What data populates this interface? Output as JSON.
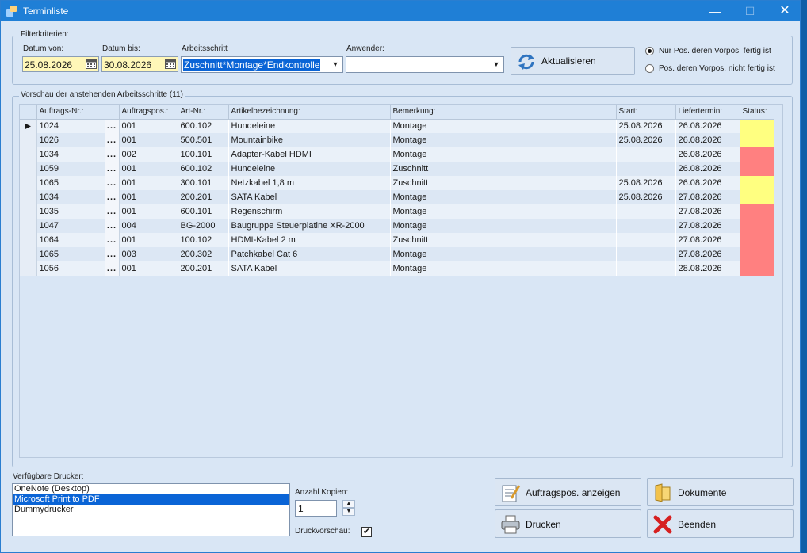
{
  "window": {
    "title": "Terminliste",
    "min": "—",
    "max": "☐",
    "close": "✕"
  },
  "filter": {
    "group_label": "Filterkriterien:",
    "date_from_label": "Datum von:",
    "date_from": "25.08.2026",
    "date_to_label": "Datum bis:",
    "date_to": "30.08.2026",
    "step_label": "Arbeitsschritt",
    "step_value": "Zuschnitt*Montage*Endkontrolle",
    "user_label": "Anwender:",
    "user_value": "",
    "refresh_label": "Aktualisieren",
    "radio_1": "Nur Pos. deren Vorpos. fertig ist",
    "radio_2": "Pos. deren Vorpos. nicht fertig ist"
  },
  "preview": {
    "group_label": "Vorschau der anstehenden Arbeitsschritte (11)",
    "columns": [
      "Auftrags-Nr.:",
      "Auftragspos.:",
      "Art-Nr.:",
      "Artikelbezeichnung:",
      "Bemerkung:",
      "Start:",
      "Liefertermin:",
      "Status:"
    ],
    "rows": [
      {
        "order": "1024",
        "pos": "001",
        "art": "600.102",
        "name": "Hundeleine",
        "note": "Montage",
        "start": "25.08.2026",
        "due": "26.08.2026",
        "status_color": "#ffff80",
        "current": true
      },
      {
        "order": "1026",
        "pos": "001",
        "art": "500.501",
        "name": "Mountainbike",
        "note": "Montage",
        "start": "25.08.2026",
        "due": "26.08.2026",
        "status_color": "#ffff80"
      },
      {
        "order": "1034",
        "pos": "002",
        "art": "100.101",
        "name": "Adapter-Kabel HDMI",
        "note": "Montage",
        "start": "",
        "due": "26.08.2026",
        "status_color": "#ff8080"
      },
      {
        "order": "1059",
        "pos": "001",
        "art": "600.102",
        "name": "Hundeleine",
        "note": "Zuschnitt",
        "start": "",
        "due": "26.08.2026",
        "status_color": "#ff8080"
      },
      {
        "order": "1065",
        "pos": "001",
        "art": "300.101",
        "name": "Netzkabel 1,8 m",
        "note": "Zuschnitt",
        "start": "25.08.2026",
        "due": "26.08.2026",
        "status_color": "#ffff80"
      },
      {
        "order": "1034",
        "pos": "001",
        "art": "200.201",
        "name": "SATA Kabel",
        "note": "Montage",
        "start": "25.08.2026",
        "due": "27.08.2026",
        "status_color": "#ffff80"
      },
      {
        "order": "1035",
        "pos": "001",
        "art": "600.101",
        "name": "Regenschirm",
        "note": "Montage",
        "start": "",
        "due": "27.08.2026",
        "status_color": "#ff8080"
      },
      {
        "order": "1047",
        "pos": "004",
        "art": "BG-2000",
        "name": "Baugruppe Steuerplatine XR-2000",
        "note": "Montage",
        "start": "",
        "due": "27.08.2026",
        "status_color": "#ff8080"
      },
      {
        "order": "1064",
        "pos": "001",
        "art": "100.102",
        "name": "HDMI-Kabel 2 m",
        "note": "Zuschnitt",
        "start": "",
        "due": "27.08.2026",
        "status_color": "#ff8080"
      },
      {
        "order": "1065",
        "pos": "003",
        "art": "200.302",
        "name": "Patchkabel Cat 6",
        "note": "Montage",
        "start": "",
        "due": "27.08.2026",
        "status_color": "#ff8080"
      },
      {
        "order": "1056",
        "pos": "001",
        "art": "200.201",
        "name": "SATA Kabel",
        "note": "Montage",
        "start": "",
        "due": "28.08.2026",
        "status_color": "#ff8080"
      }
    ]
  },
  "printers": {
    "label": "Verfügbare Drucker:",
    "items": [
      "OneNote (Desktop)",
      "Microsoft Print to PDF",
      "Dummydrucker"
    ],
    "selected": 1
  },
  "copies": {
    "label": "Anzahl Kopien:",
    "value": "1"
  },
  "preview_print": {
    "label": "Druckvorschau:",
    "checked": true
  },
  "buttons": {
    "show_pos": "Auftragspos. anzeigen",
    "documents": "Dokumente",
    "print": "Drucken",
    "exit": "Beenden"
  }
}
